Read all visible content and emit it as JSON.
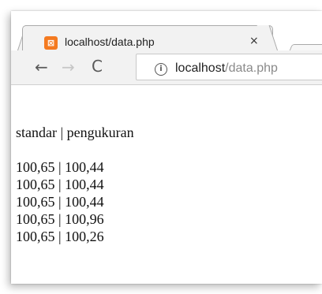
{
  "browser": {
    "tab": {
      "title": "localhost/data.php",
      "favicon": "xampp-icon",
      "close_glyph": "×"
    },
    "toolbar": {
      "back_icon": "back-arrow-icon",
      "forward_icon": "forward-arrow-icon",
      "reload_icon": "reload-icon",
      "address": {
        "info_icon": "info-icon",
        "host": "localhost",
        "path": "/data.php"
      }
    },
    "accent_color": "#f47a20"
  },
  "page": {
    "header": {
      "col1": "standar",
      "sep": " | ",
      "col2": "pengukuran"
    },
    "rows": [
      {
        "standar": "100,65",
        "pengukuran": "100,44"
      },
      {
        "standar": "100,65",
        "pengukuran": "100,44"
      },
      {
        "standar": "100,65",
        "pengukuran": "100,44"
      },
      {
        "standar": "100,65",
        "pengukuran": "100,96"
      },
      {
        "standar": "100,65",
        "pengukuran": "100,26"
      }
    ],
    "separator": " | "
  }
}
